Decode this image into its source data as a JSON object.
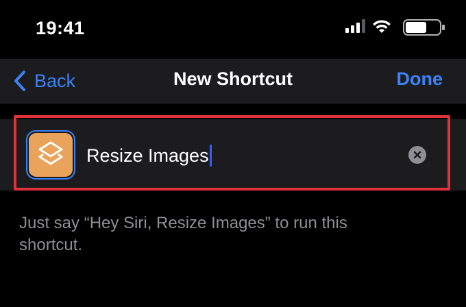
{
  "status_bar": {
    "time": "19:41",
    "icons": [
      "cellular-signal-icon",
      "wifi-icon",
      "battery-icon"
    ]
  },
  "nav": {
    "back_label": "Back",
    "title": "New Shortcut",
    "done_label": "Done"
  },
  "shortcut": {
    "name": "Resize Images",
    "icon": "shortcuts-layers-icon",
    "icon_color": "#e9a35b"
  },
  "hint": "Just say “Hey Siri, Resize Images” to run this shortcut.",
  "colors": {
    "accent": "#3a82f7",
    "highlight": "#e0323a",
    "background": "#000000",
    "row_background": "#1c1c1e",
    "secondary_text": "#8e8e93"
  }
}
